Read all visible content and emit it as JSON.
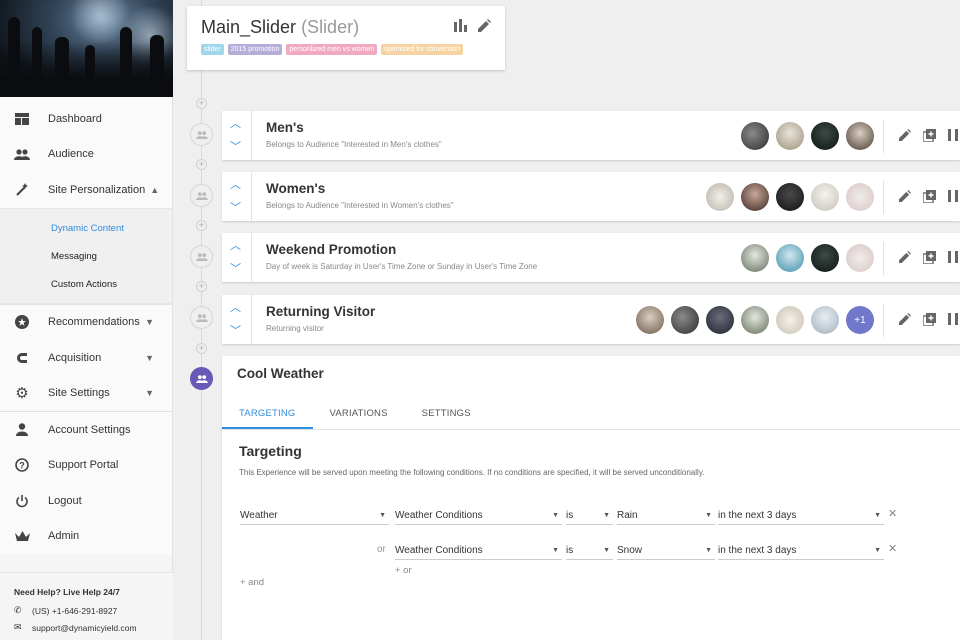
{
  "sidebar": {
    "nav": [
      {
        "label": "Dashboard",
        "icon": "dashboard-icon"
      },
      {
        "label": "Audience",
        "icon": "people-icon"
      },
      {
        "label": "Site Personalization",
        "icon": "magic-wand-icon",
        "expanded": true
      }
    ],
    "subnav": [
      {
        "label": "Dynamic Content",
        "active": true
      },
      {
        "label": "Messaging"
      },
      {
        "label": "Custom Actions"
      }
    ],
    "nav2": [
      {
        "label": "Recommendations",
        "icon": "star-icon"
      },
      {
        "label": "Acquisition",
        "icon": "magnet-icon"
      },
      {
        "label": "Site Settings",
        "icon": "gear-icon"
      }
    ],
    "nav3": [
      {
        "label": "Account Settings",
        "icon": "person-icon"
      },
      {
        "label": "Support Portal",
        "icon": "help-icon"
      },
      {
        "label": "Logout",
        "icon": "power-icon"
      },
      {
        "label": "Admin",
        "icon": "crown-icon"
      }
    ],
    "help": {
      "title": "Need Help? Live Help 24/7",
      "phone": "(US) +1-646-291-8927",
      "email": "support@dynamicyield.com"
    }
  },
  "slider": {
    "name": "Main_Slider",
    "type": "(Slider)",
    "tags": [
      {
        "label": "slider",
        "color": "#9fd6ea"
      },
      {
        "label": "2015 promotion",
        "color": "#b4aed8"
      },
      {
        "label": "personlized men vs women",
        "color": "#f1a9c1"
      },
      {
        "label": "optimized for conversion",
        "color": "#f5d4a4"
      }
    ]
  },
  "experiences": [
    {
      "title": "Men's",
      "subtitle": "Belongs to Audience \"Interested in Men's clothes\"",
      "avatars": 4,
      "more": ""
    },
    {
      "title": "Women's",
      "subtitle": "Belongs to Audience \"Interested in Women's clothes\"",
      "avatars": 5,
      "more": ""
    },
    {
      "title": "Weekend Promotion",
      "subtitle": "Day of week is Saturday in User's Time Zone or Sunday in User's Time Zone",
      "avatars": 4,
      "more": ""
    },
    {
      "title": "Returning Visitor",
      "subtitle": "Returning visitor",
      "avatars": 6,
      "more": "+1"
    }
  ],
  "detail": {
    "title": "Cool Weather",
    "tabs": [
      "TARGETING",
      "VARIATIONS",
      "SETTINGS"
    ],
    "section_title": "Targeting",
    "section_desc": "This Experience will be served upon meeting the following conditions. If no conditions are specified, it will be served unconditionally.",
    "conditions": [
      {
        "prefix": "",
        "type": "Weather",
        "field": "Weather Conditions",
        "op": "is",
        "value": "Rain",
        "when": "in the next 3 days"
      },
      {
        "prefix": "or",
        "type": "",
        "field": "Weather Conditions",
        "op": "is",
        "value": "Snow",
        "when": "in the next 3 days"
      }
    ],
    "add_or": "+ or",
    "add_and": "+ and"
  },
  "colors": {
    "accent": "#2f8ddf",
    "active_node": "#6a58b7"
  }
}
